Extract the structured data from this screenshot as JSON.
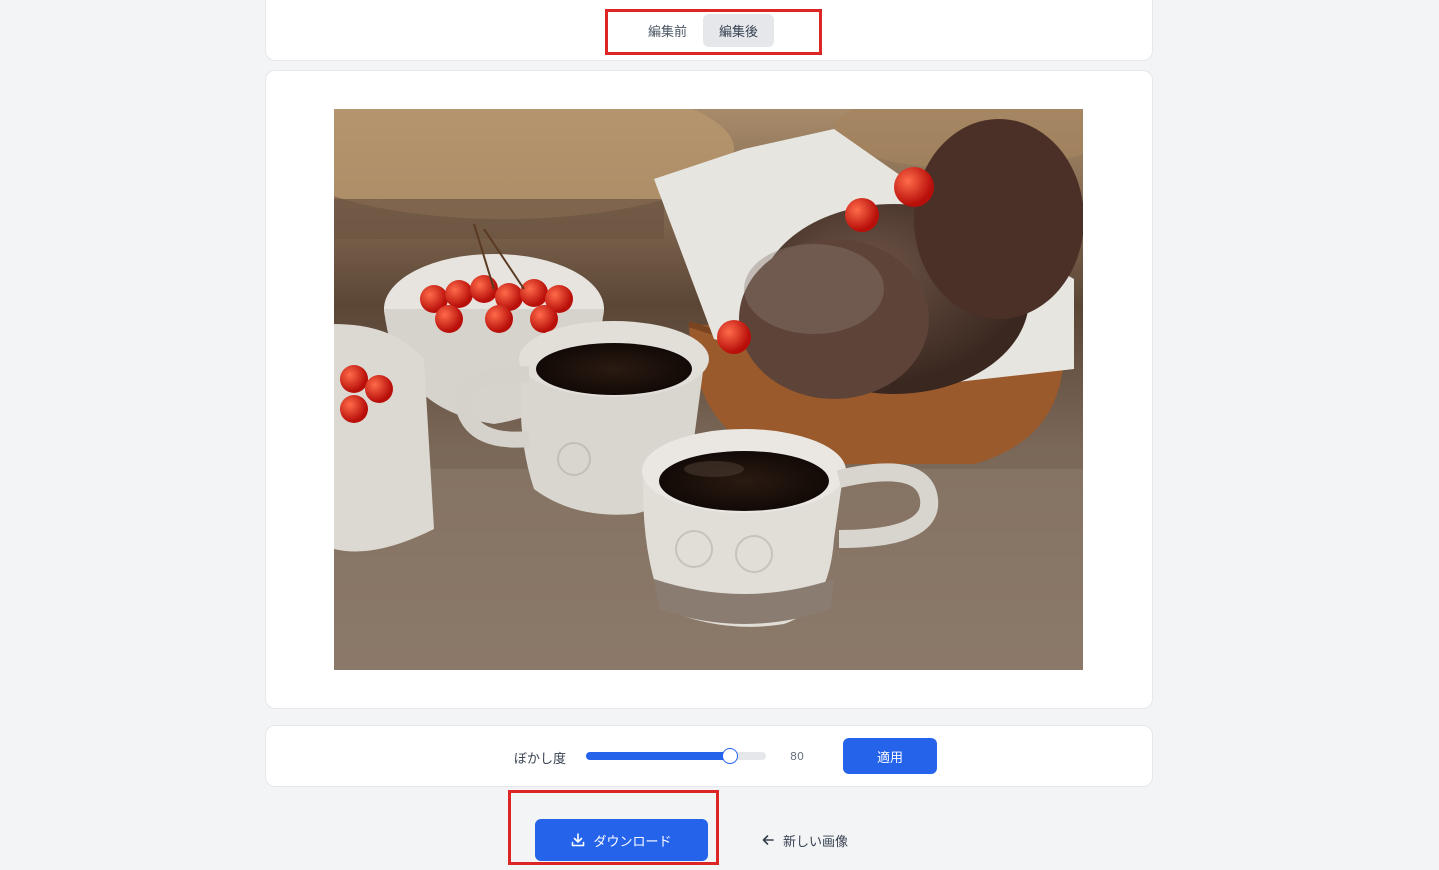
{
  "view_toggle": {
    "before_label": "編集前",
    "after_label": "編集後",
    "active": "after"
  },
  "image": {
    "description_icon": "photo-icon"
  },
  "blur_control": {
    "label": "ぼかし度",
    "value": 80,
    "value_text": "80",
    "min": 0,
    "max": 100,
    "apply_label": "適用"
  },
  "actions": {
    "download_label": "ダウンロード",
    "new_image_label": "新しい画像",
    "download_icon": "download-icon",
    "back_icon": "arrow-left-icon"
  },
  "colors": {
    "accent": "#2563eb",
    "highlight": "#dc2626",
    "background": "#f3f4f6"
  }
}
